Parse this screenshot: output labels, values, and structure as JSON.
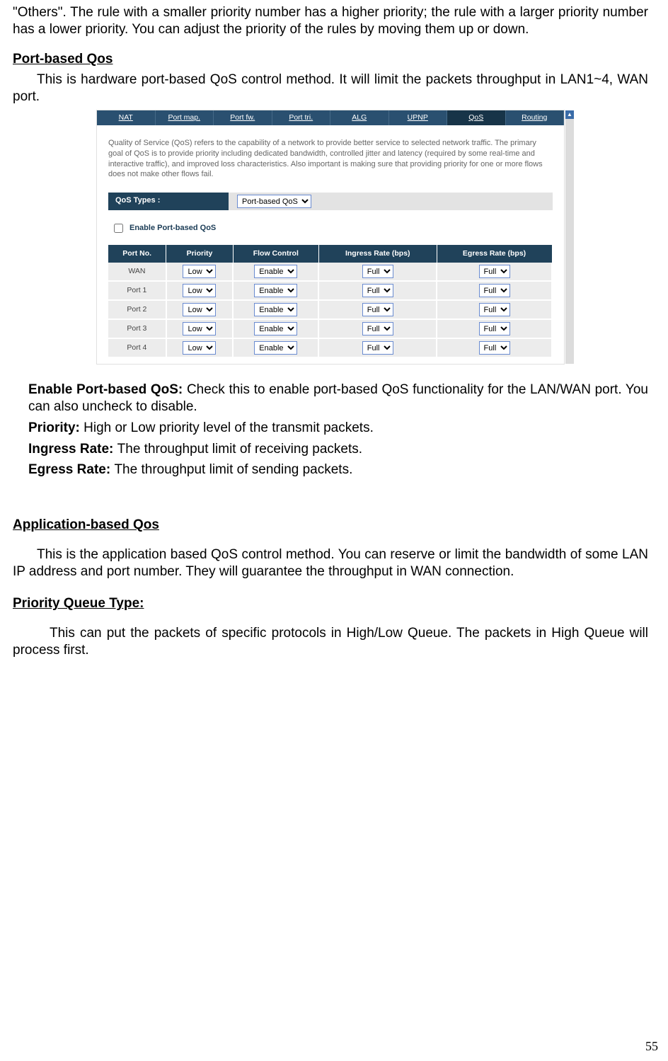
{
  "intro_para": "\"Others\". The rule with a smaller priority number has a higher priority; the rule with a larger priority number has a lower priority. You can adjust the priority of the rules by moving them up or down.",
  "portqos": {
    "heading": "Port-based Qos",
    "para": "This is hardware port-based QoS control method. It will limit the packets throughput in LAN1~4, WAN port."
  },
  "figure": {
    "tabs": [
      "NAT",
      "Port map.",
      "Port fw.",
      "Port tri.",
      "ALG",
      "UPNP",
      "QoS",
      "Routing"
    ],
    "active_tab_index": 6,
    "intro": "Quality of Service (QoS) refers to the capability of a network to provide better service to selected network traffic. The primary goal of QoS is to provide priority including dedicated bandwidth, controlled jitter and latency (required by some real-time and interactive traffic), and improved loss characteristics. Also important is making sure that providing priority for one or more flows does not make other flows fail.",
    "types_label": "QoS Types :",
    "types_selected": "Port-based QoS",
    "enable_label": "Enable Port-based QoS",
    "enable_checked": false,
    "columns": [
      "Port No.",
      "Priority",
      "Flow Control",
      "Ingress Rate (bps)",
      "Egress Rate (bps)"
    ],
    "rows": [
      {
        "port": "WAN",
        "priority": "Low",
        "flow": "Enable",
        "ingress": "Full",
        "egress": "Full"
      },
      {
        "port": "Port 1",
        "priority": "Low",
        "flow": "Enable",
        "ingress": "Full",
        "egress": "Full"
      },
      {
        "port": "Port 2",
        "priority": "Low",
        "flow": "Enable",
        "ingress": "Full",
        "egress": "Full"
      },
      {
        "port": "Port 3",
        "priority": "Low",
        "flow": "Enable",
        "ingress": "Full",
        "egress": "Full"
      },
      {
        "port": "Port 4",
        "priority": "Low",
        "flow": "Enable",
        "ingress": "Full",
        "egress": "Full"
      }
    ]
  },
  "defs": {
    "enable_label": "Enable Port-based QoS: ",
    "enable_text": "Check this to enable port-based QoS functionality for the LAN/WAN port. You can also uncheck to disable.",
    "priority_label": "Priority: ",
    "priority_text": "High or Low priority level of the transmit packets.",
    "ingress_label": "Ingress Rate: ",
    "ingress_text": "The throughput limit of receiving packets.",
    "egress_label": "Egress Rate: ",
    "egress_text": "The throughput limit of sending packets."
  },
  "appqos": {
    "heading": "Application-based Qos",
    "para": "This is the application based QoS control method. You can reserve or limit the bandwidth of some LAN IP address and port number. They will guarantee the throughput in WAN connection."
  },
  "pqtype": {
    "heading": "Priority Queue Type:  ",
    "para": "This can put the packets of specific protocols in High/Low Queue. The packets in High Queue will process first."
  },
  "page_number": "55"
}
